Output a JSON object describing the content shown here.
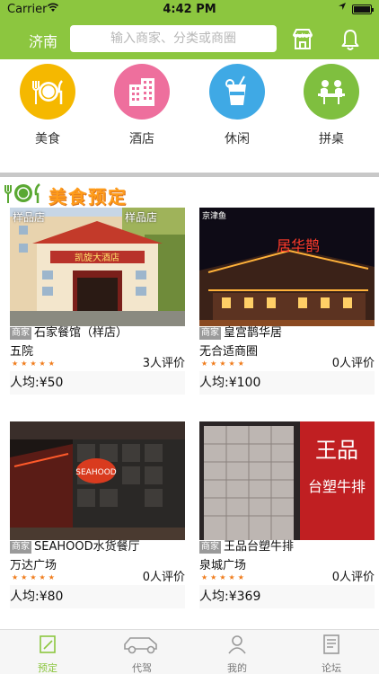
{
  "status": {
    "carrier": "Carrier",
    "time": "4:42 PM"
  },
  "nav": {
    "city": "济南",
    "search_placeholder": "输入商家、分类或商圈"
  },
  "categories": [
    {
      "label": "美食",
      "color": "#f5b800",
      "icon": "dining-icon"
    },
    {
      "label": "酒店",
      "color": "#ee6f9d",
      "icon": "hotel-icon"
    },
    {
      "label": "休闲",
      "color": "#3fa9e5",
      "icon": "drink-icon"
    },
    {
      "label": "拼桌",
      "color": "#7fbf3f",
      "icon": "shared-table-icon"
    }
  ],
  "section": {
    "title": "美食预定"
  },
  "cards": [
    {
      "tag": "商家",
      "name": "石家餐馆（样店）",
      "area": "五院",
      "reviews": "3人评价",
      "price": "人均:¥50",
      "photo_caption": "样品店",
      "hotel_sign": "凯旋大酒店"
    },
    {
      "tag": "商家",
      "name": "皇宫鹊华居",
      "area": "无合适商圈",
      "reviews": "0人评价",
      "price": "人均:¥100",
      "photo_caption": "京津鱼",
      "neon_sign": "居华鹊"
    },
    {
      "tag": "商家",
      "name": "SEAHOOD水货餐厅",
      "area": "万达广场",
      "reviews": "0人评价",
      "price": "人均:¥80",
      "neon_sign": "SEAHOOD"
    },
    {
      "tag": "商家",
      "name": "王品台塑牛排",
      "area": "泉城广场",
      "reviews": "0人评价",
      "price": "人均:¥369",
      "big_sign": "王品",
      "small_sign": "台塑牛排"
    }
  ],
  "tabs": [
    {
      "label": "预定",
      "icon": "book-icon",
      "active": true
    },
    {
      "label": "代驾",
      "icon": "car-icon",
      "active": false
    },
    {
      "label": "我的",
      "icon": "user-icon",
      "active": false
    },
    {
      "label": "论坛",
      "icon": "forum-icon",
      "active": false
    }
  ],
  "colors": {
    "brand": "#8cc63f",
    "star": "#f07c1c",
    "section_title": "#ff9c1a"
  }
}
